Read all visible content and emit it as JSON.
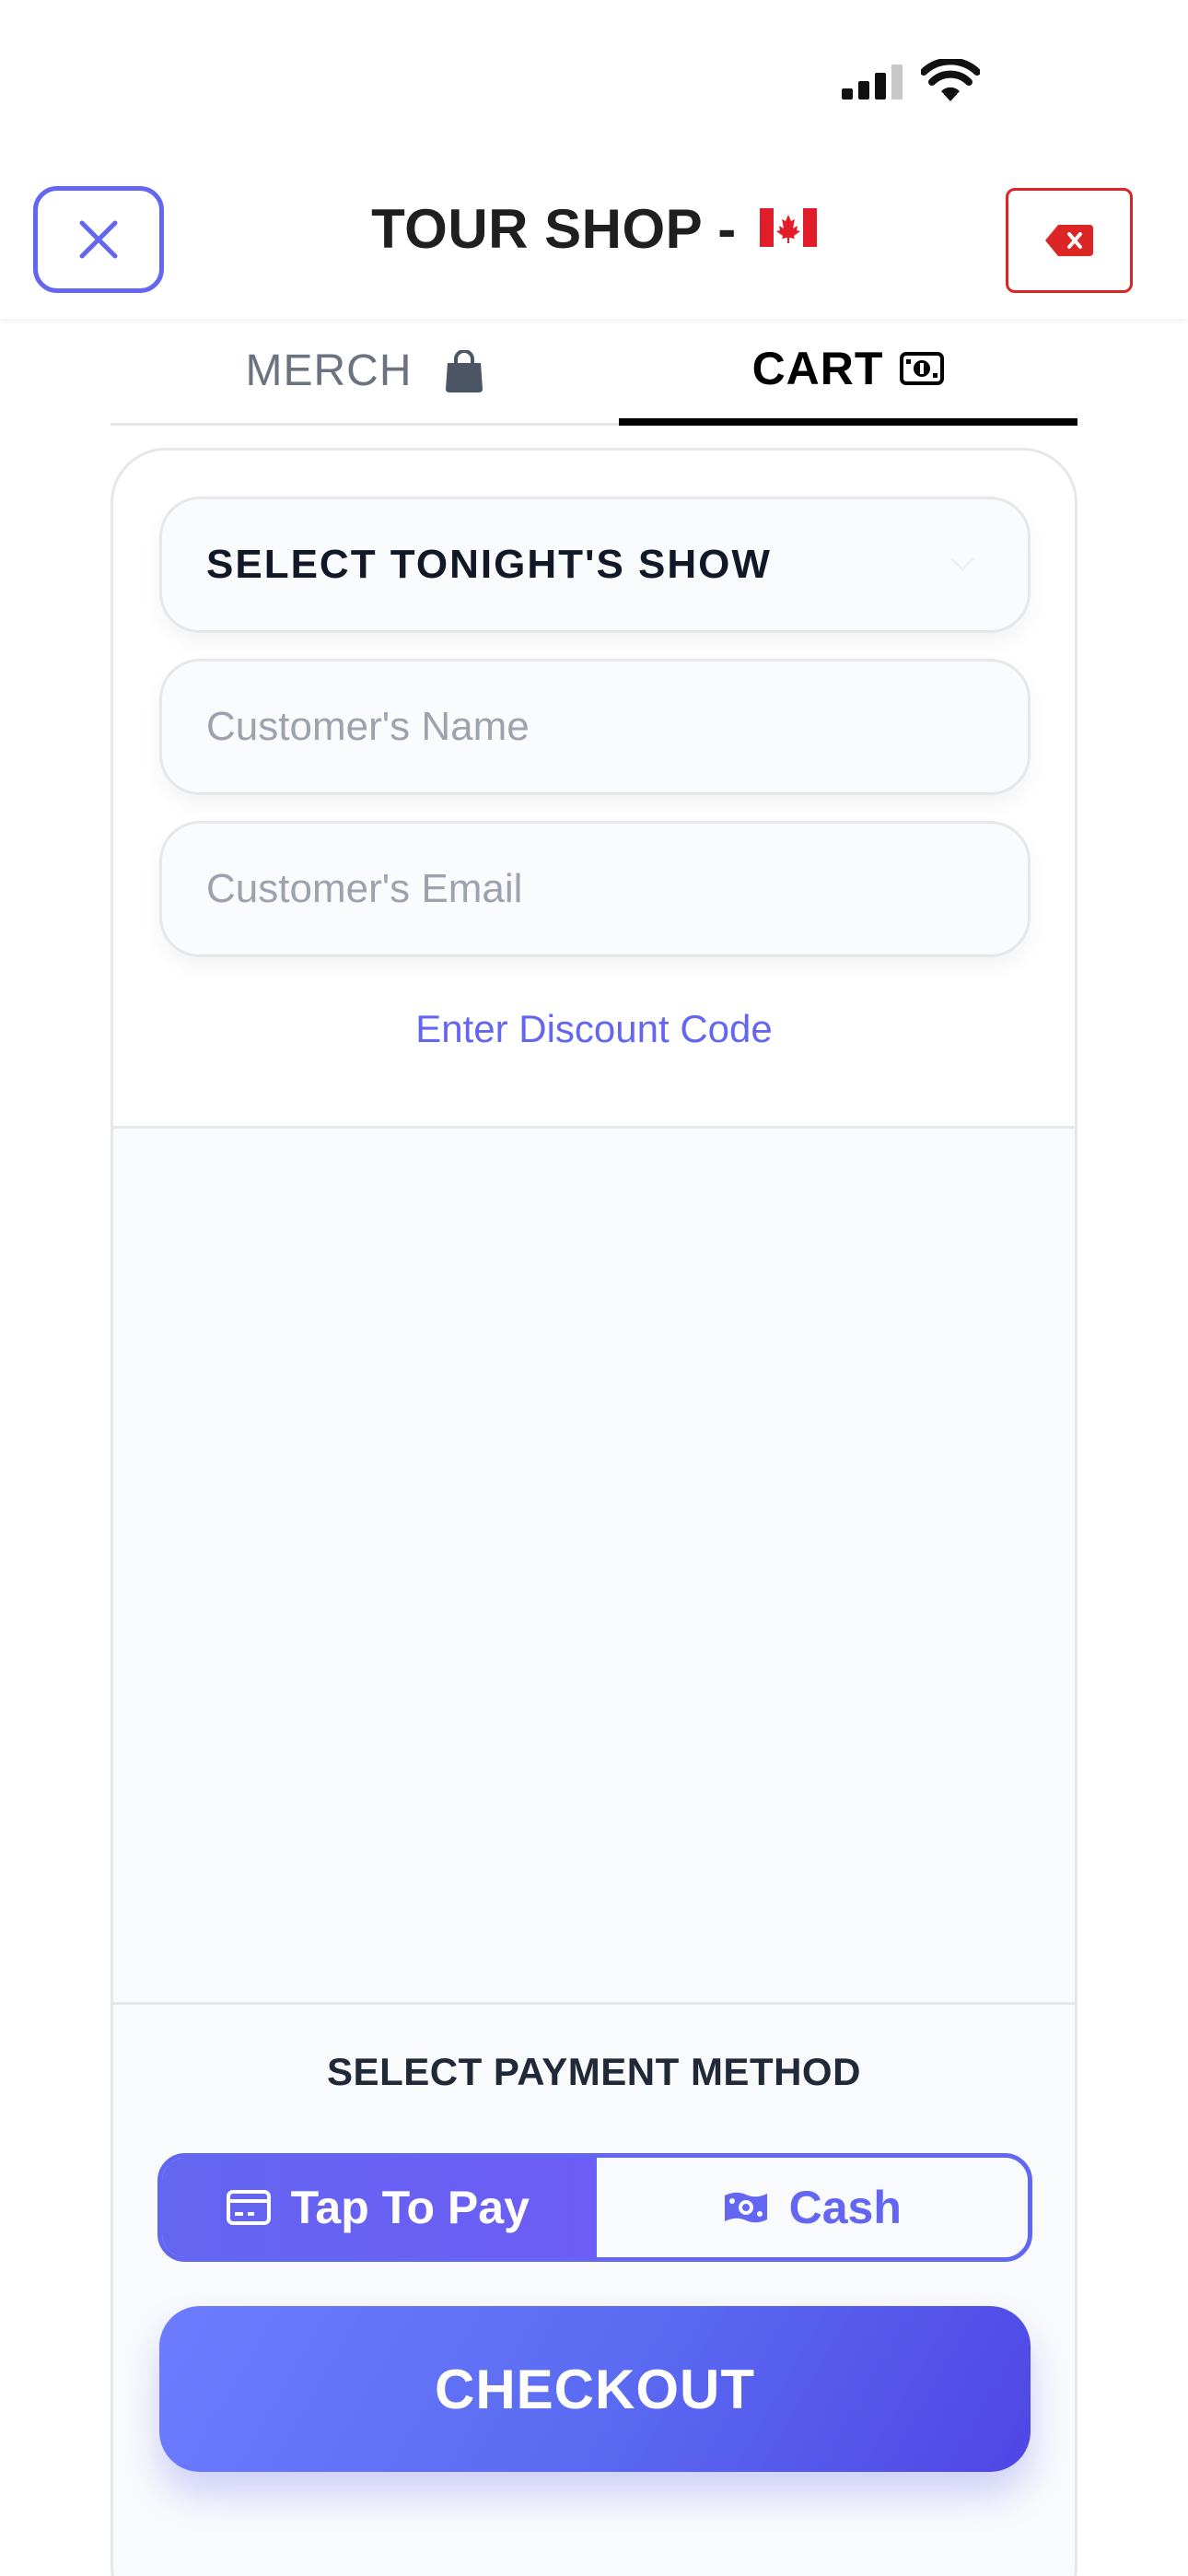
{
  "header": {
    "title": "TOUR SHOP -"
  },
  "tabs": [
    {
      "label": "MERCH",
      "icon": "shopping-bag-icon"
    },
    {
      "label": "CART",
      "icon": "cash-icon"
    }
  ],
  "form": {
    "show_select_value": "SELECT TONIGHT'S SHOW",
    "name_placeholder": "Customer's Name",
    "email_placeholder": "Customer's Email",
    "discount_link": "Enter Discount Code"
  },
  "payment": {
    "label": "SELECT PAYMENT METHOD",
    "options": [
      {
        "label": "Tap To Pay",
        "icon": "credit-card-icon",
        "selected": true
      },
      {
        "label": "Cash",
        "icon": "cash-icon",
        "selected": false
      }
    ]
  },
  "checkout_label": "CHECKOUT",
  "colors": {
    "accent": "#6366f1",
    "danger": "#dc2626",
    "tab_active": "#000000",
    "muted": "#9ca3af"
  }
}
